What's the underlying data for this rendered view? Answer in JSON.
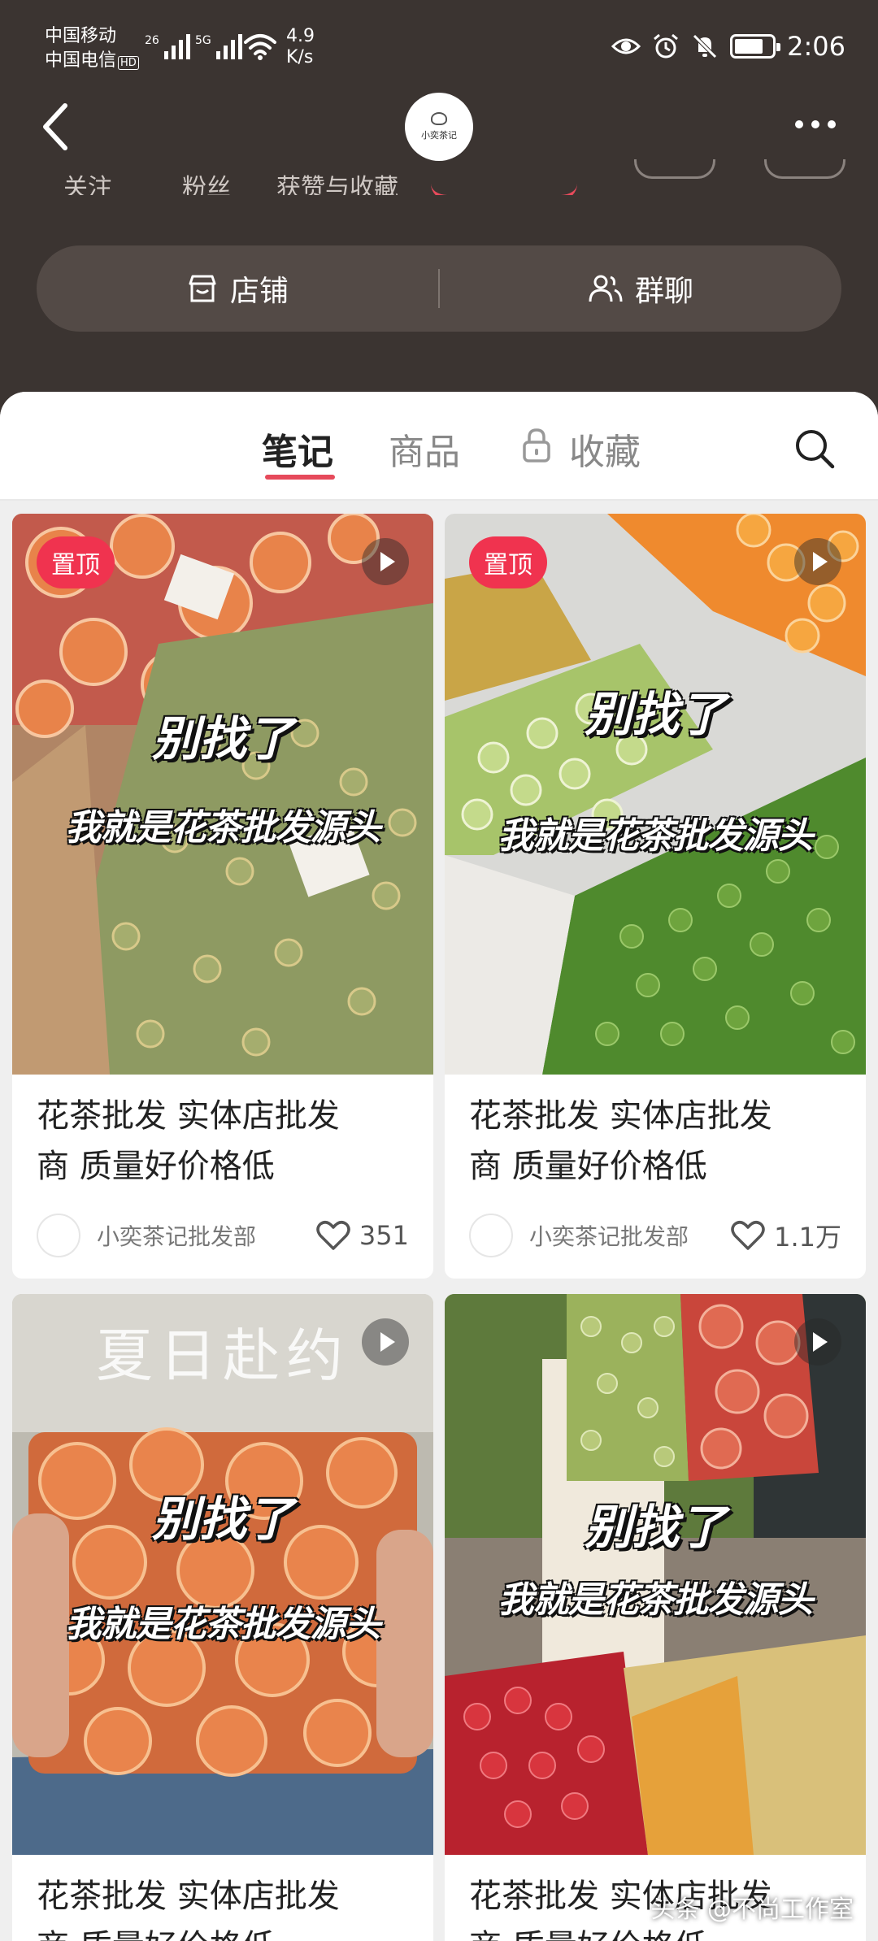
{
  "status_bar": {
    "carrier_1": "中国移动",
    "carrier_2": "中国电信",
    "carrier_2_badge": "HD",
    "signal_1_label": "26",
    "signal_2_label": "5G",
    "net_speed_value": "4.9",
    "net_speed_unit": "K/s",
    "time": "2:06"
  },
  "nav": {
    "avatar_text": "小奕茶记"
  },
  "profile_stats": {
    "follow": "关注",
    "fans": "粉丝",
    "likes_collects": "获赞与收藏"
  },
  "actions": {
    "shop": "店铺",
    "group_chat": "群聊"
  },
  "tabs": {
    "notes": "笔记",
    "products": "商品",
    "collections": "收藏"
  },
  "notes": [
    {
      "pinned_badge": "置顶",
      "overlay_title": "别找了",
      "overlay_subtitle": "我就是花茶批发源头",
      "title_line_1": "花茶批发 实体店批发",
      "title_line_2": "商 质量好价格低",
      "author": "小奕茶记批发部",
      "likes": "351"
    },
    {
      "pinned_badge": "置顶",
      "overlay_title": "别找了",
      "overlay_subtitle": "我就是花茶批发源头",
      "title_line_1": "花茶批发 实体店批发",
      "title_line_2": "商 质量好价格低",
      "author": "小奕茶记批发部",
      "likes": "1.1万"
    },
    {
      "overlay_script": "夏日赴约",
      "overlay_title": "别找了",
      "overlay_subtitle": "我就是花茶批发源头",
      "title_line_1": "花茶批发 实体店批发",
      "title_line_2": "商 质量好价格低"
    },
    {
      "overlay_title": "别找了",
      "overlay_subtitle": "我就是花茶批发源头",
      "title_line_1": "花茶批发 实体店批发",
      "title_line_2": "商 质量好价格低"
    }
  ],
  "watermark": "头条 @不尚工作室",
  "colors": {
    "header_bg": "#3b3431",
    "accent_red": "#e64a5b",
    "badge_red": "#f0334f"
  }
}
